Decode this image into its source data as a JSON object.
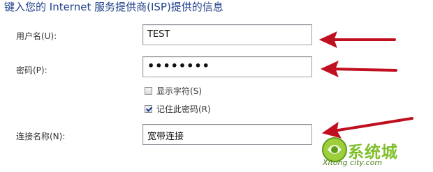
{
  "heading": "键入您的 Internet 服务提供商(ISP)提供的信息",
  "form": {
    "username_label": "用户名(U):",
    "username_value": "TEST",
    "password_label": "密码(P):",
    "password_value": "••••••••",
    "show_chars_label": "显示字符(S)",
    "show_chars_checked": false,
    "remember_label": "记住此密码(R)",
    "remember_checked": true,
    "conn_name_label": "连接名称(N):",
    "conn_name_value": "宽带连接"
  },
  "watermark": {
    "text": "系统城",
    "url": "Xitong city.com"
  },
  "colors": {
    "heading": "#1e3f8a",
    "arrow": "#c01020",
    "logo_green": "#7fbf2a"
  }
}
